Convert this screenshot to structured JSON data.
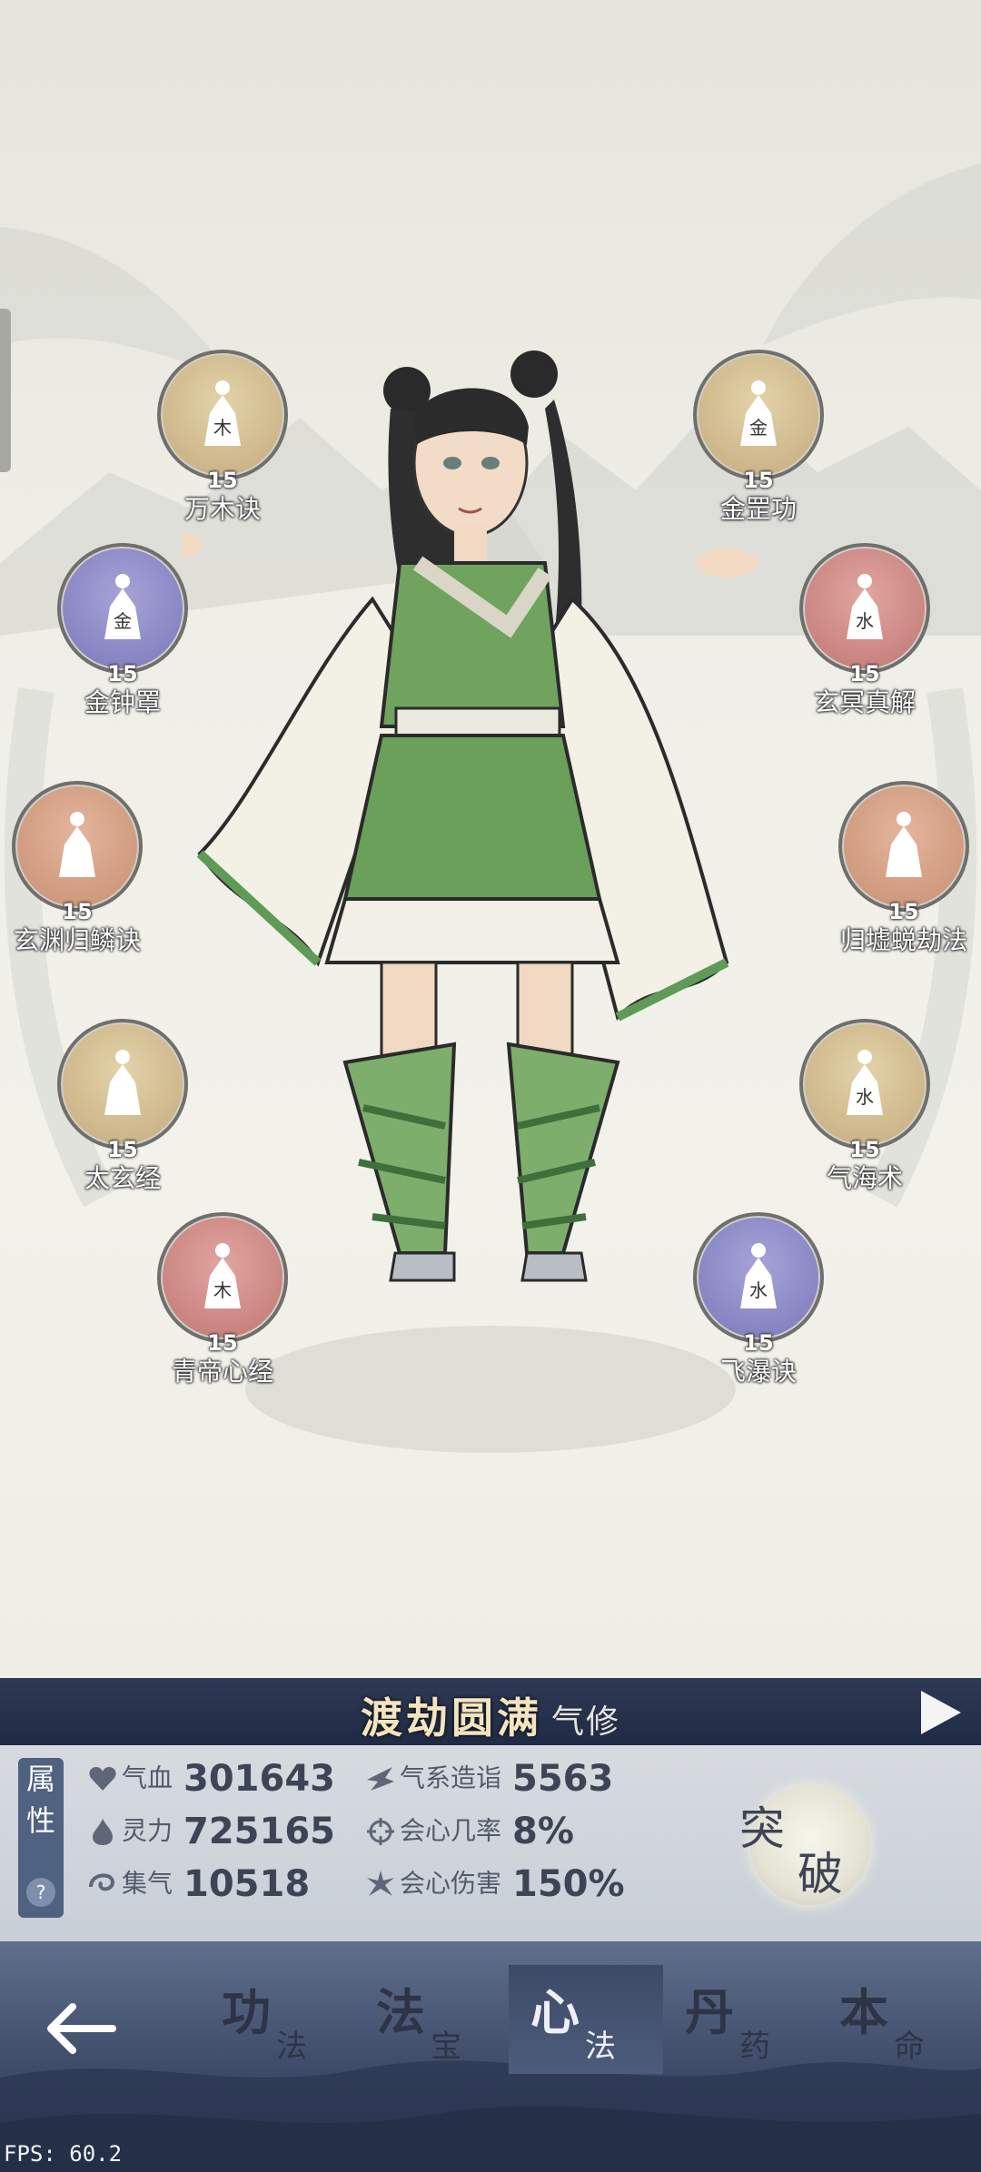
{
  "skills_left": [
    {
      "name": "万木诀",
      "level": "15",
      "element": "木",
      "tone": "gold"
    },
    {
      "name": "金钟罩",
      "level": "15",
      "element": "金",
      "tone": "purple"
    },
    {
      "name": "玄渊归鳞诀",
      "level": "15",
      "element": "",
      "tone": "copper"
    },
    {
      "name": "太玄经",
      "level": "15",
      "element": "",
      "tone": "gold"
    },
    {
      "name": "青帝心经",
      "level": "15",
      "element": "木",
      "tone": "red"
    }
  ],
  "skills_right": [
    {
      "name": "金罡功",
      "level": "15",
      "element": "金",
      "tone": "gold"
    },
    {
      "name": "玄冥真解",
      "level": "15",
      "element": "水",
      "tone": "red"
    },
    {
      "name": "归墟蜕劫法",
      "level": "15",
      "element": "",
      "tone": "copper"
    },
    {
      "name": "气海术",
      "level": "15",
      "element": "水",
      "tone": "gold"
    },
    {
      "name": "飞瀑诀",
      "level": "15",
      "element": "水",
      "tone": "purple"
    }
  ],
  "realm": {
    "title": "渡劫圆满",
    "type": "气修"
  },
  "attributes": {
    "tab_label_1": "属",
    "tab_label_2": "性",
    "help": "?",
    "qixue": {
      "label": "气血",
      "value": "301643"
    },
    "lingli": {
      "label": "灵力",
      "value": "725165"
    },
    "jiqi": {
      "label": "集气",
      "value": "10518"
    },
    "qixi": {
      "label": "气系造诣",
      "value": "5563"
    },
    "huixin_rate": {
      "label": "会心几率",
      "value": "8%"
    },
    "huixin_dmg": {
      "label": "会心伤害",
      "value": "150%"
    }
  },
  "breakthrough": {
    "char1": "突",
    "char2": "破"
  },
  "nav": {
    "back_icon": "arrow-left-icon",
    "tabs": [
      {
        "big": "功",
        "small": "法",
        "active": false
      },
      {
        "big": "法",
        "small": "宝",
        "active": false
      },
      {
        "big": "心",
        "small": "法",
        "active": true
      },
      {
        "big": "丹",
        "small": "药",
        "active": false
      },
      {
        "big": "本",
        "small": "命",
        "active": false
      }
    ]
  },
  "fps": "FPS: 60.2",
  "colors": {
    "panel_dark": "#1f2a44",
    "stats_bg": "#d7dbe0",
    "accent_gold": "#f3e4c0"
  }
}
